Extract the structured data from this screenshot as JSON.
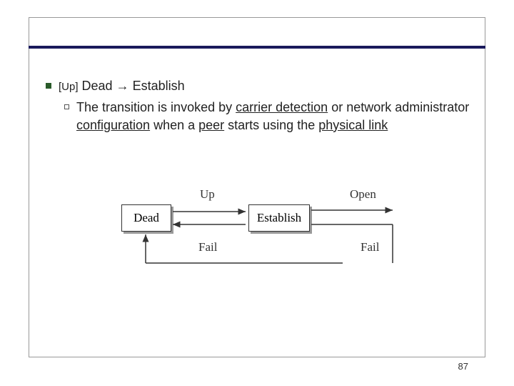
{
  "bullet1": {
    "up": "[Up]",
    "dead": "Dead",
    "arrow": "→",
    "establish": "Establish"
  },
  "bullet2": {
    "t1": "The transition is invoked by ",
    "u1": "carrier detection",
    "t2": " or network administrator ",
    "u2": "configuration",
    "t3": " when a ",
    "u3": "peer",
    "t4": " starts using the ",
    "u4": "physical link"
  },
  "diagram": {
    "dead": "Dead",
    "establish": "Establish",
    "up": "Up",
    "fail": "Fail",
    "open": "Open"
  },
  "page": "87"
}
